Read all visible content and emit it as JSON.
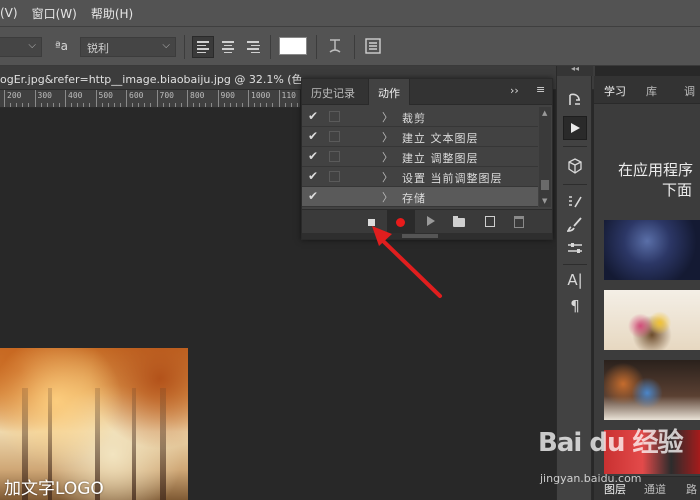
{
  "menu": {
    "items": [
      "(V)",
      "窗口(W)",
      "帮助(H)"
    ]
  },
  "options": {
    "font_style": "",
    "aa_label": "ªa",
    "antialias": "锐利",
    "chevron": "⌵"
  },
  "document": {
    "tab_title": "ogEr.jpg&refer=http__image.biaobaiju.jpg @ 32.1% (色"
  },
  "ruler": {
    "labels": [
      "200",
      "300",
      "400",
      "500",
      "600",
      "700",
      "800",
      "900",
      "1000",
      "110"
    ]
  },
  "canvas": {
    "watermark_text": "加文字LOGO"
  },
  "actions_panel": {
    "tabs": [
      "历史记录",
      "动作"
    ],
    "active_tab": "动作",
    "expand_icon": "››",
    "menu_icon": "≡",
    "rows": [
      {
        "check": "✔",
        "arrow": "〉",
        "label": "裁剪",
        "selected": false
      },
      {
        "check": "✔",
        "arrow": "〉",
        "label": "建立 文本图层",
        "selected": false
      },
      {
        "check": "✔",
        "arrow": "〉",
        "label": "建立 调整图层",
        "selected": false
      },
      {
        "check": "✔",
        "arrow": "〉",
        "label": "设置 当前调整图层",
        "selected": false
      },
      {
        "check": "✔",
        "arrow": "〉",
        "label": "存储",
        "selected": true
      }
    ]
  },
  "toolstrip": {
    "collapse": "◂◂",
    "tools": [
      "history-brush-icon",
      "play-icon",
      "cube-icon",
      "brush-settings-icon",
      "brush-icon",
      "adjust-icon",
      "character-icon",
      "paragraph-icon"
    ],
    "char_glyph": "A|",
    "para_glyph": "¶"
  },
  "learn_panel": {
    "tabs": [
      "学习",
      "库",
      "调"
    ],
    "active_tab": "学习",
    "headline_1": "在应用程序",
    "headline_2": "下面",
    "bottom_tabs": [
      "图层",
      "通道",
      "路"
    ]
  },
  "watermark": {
    "brand": "Bai du 经验",
    "url": "jingyan.baidu.com"
  },
  "colors": {
    "record": "#e81b1b",
    "arrow": "#e01e1e",
    "panel": "#424242",
    "chrome": "#535353"
  }
}
